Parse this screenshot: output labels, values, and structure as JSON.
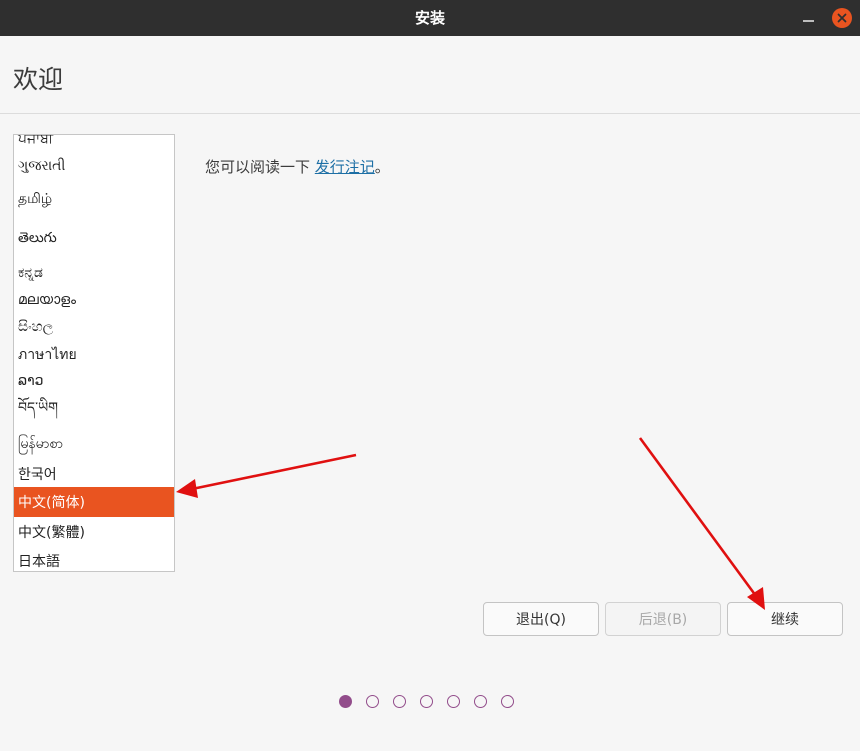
{
  "window": {
    "title": "安装",
    "minimize_icon": "minimize-icon",
    "close_icon": "close-icon",
    "accent": "#e95420"
  },
  "header": {
    "title": "欢迎"
  },
  "languages": {
    "items": [
      "ਪੰਜਾਬੀ",
      "ગુજરાતી",
      "தமிழ்",
      "తెలుగు",
      "ಕನ್ನಡ",
      "മലയാളം",
      "සිංහල",
      "ภาษาไทย",
      "ລາວ",
      "བོད་ཡིག",
      "မြန်မာစာ",
      "한국어",
      "中文(简体)",
      "中文(繁體)",
      "日本語"
    ],
    "selected": "中文(简体)"
  },
  "release_notes": {
    "prefix": "您可以阅读一下 ",
    "link": "发行注记",
    "suffix": "。"
  },
  "buttons": {
    "quit": "退出(Q)",
    "back": "后退(B)",
    "continue": "继续"
  },
  "progress": {
    "total_steps": 7,
    "current_step": 1
  },
  "colors": {
    "accent": "#e95420",
    "progress": "#924d8b",
    "link": "#1d6fa5",
    "annotation_arrow": "#e01010"
  }
}
